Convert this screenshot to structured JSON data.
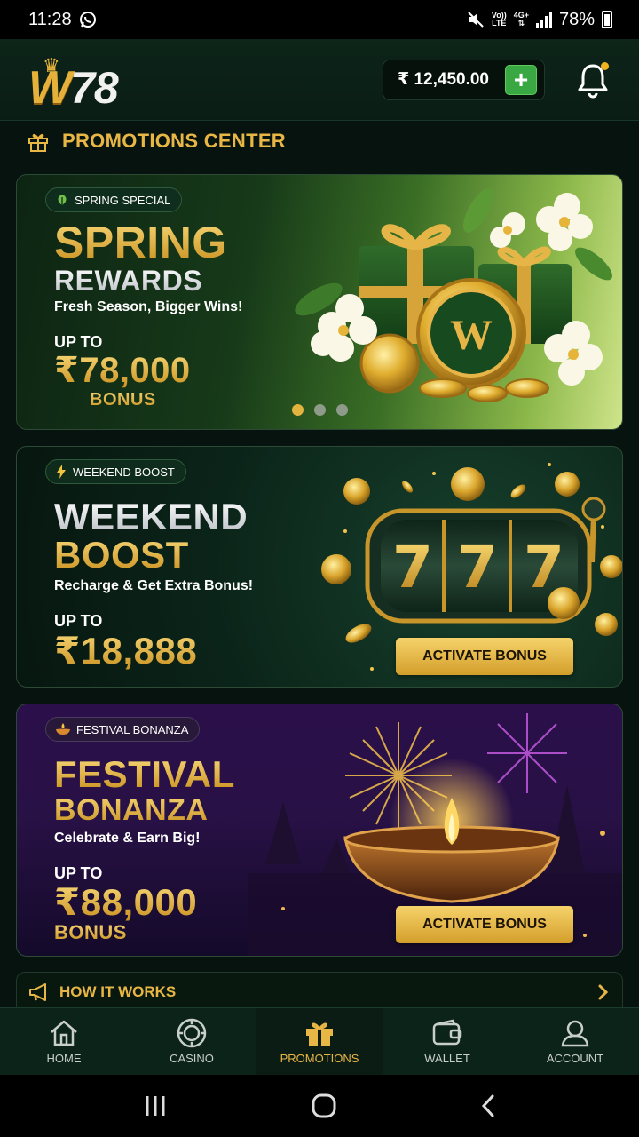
{
  "status_bar": {
    "time": "11:28",
    "network_top": "Vo))",
    "network_bottom": "LTE",
    "gen_top": "4G+",
    "battery": "78%"
  },
  "header": {
    "logo_w": "W",
    "logo_num": "78",
    "balance": "₹ 12,450.00",
    "add_label": "+"
  },
  "section": {
    "title": "PROMOTIONS CENTER"
  },
  "promos": [
    {
      "tag": "SPRING SPECIAL",
      "title_line1": "SPRING",
      "title_line2": "REWARDS",
      "subtitle": "Fresh Season, Bigger Wins!",
      "upto": "UP TO",
      "amount": "₹78,000",
      "amount_suffix": "BONUS",
      "coin_letter": "W"
    },
    {
      "tag": "WEEKEND BOOST",
      "title_line1": "WEEKEND",
      "title_line2": "BOOST",
      "subtitle": "Recharge & Get Extra Bonus!",
      "upto": "UP TO",
      "amount": "₹18,888",
      "cta": "ACTIVATE BONUS",
      "slot_reels": [
        "7",
        "7",
        "7"
      ]
    },
    {
      "tag": "FESTIVAL BONANZA",
      "title_line1": "FESTIVAL",
      "title_line2": "BONANZA",
      "subtitle": "Celebrate & Earn Big!",
      "upto": "UP TO",
      "amount": "₹88,000",
      "amount_suffix": "BONUS",
      "cta": "ACTIVATE BONUS"
    }
  ],
  "carousel": {
    "count": 3,
    "active": 0
  },
  "how_it_works": {
    "label": "HOW IT WORKS"
  },
  "bottom_nav": [
    {
      "label": "HOME",
      "icon": "home-icon"
    },
    {
      "label": "CASINO",
      "icon": "casino-chip-icon"
    },
    {
      "label": "PROMOTIONS",
      "icon": "gift-icon",
      "active": true
    },
    {
      "label": "WALLET",
      "icon": "wallet-icon"
    },
    {
      "label": "ACCOUNT",
      "icon": "account-icon"
    }
  ],
  "colors": {
    "gold": "#e8b644",
    "green_button": "#3aa842",
    "background": "#07130f"
  }
}
